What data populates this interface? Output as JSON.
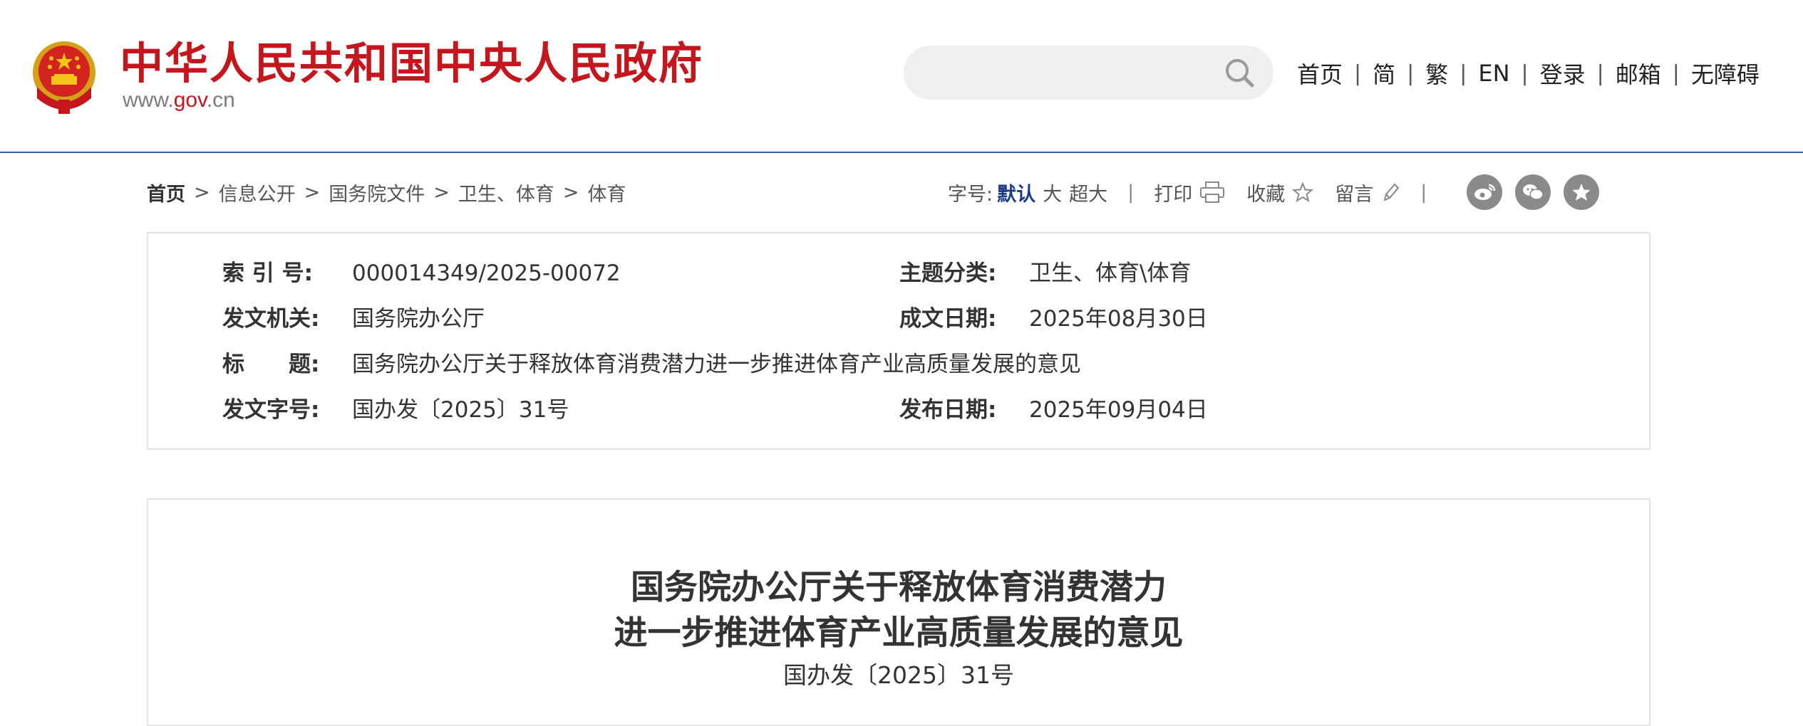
{
  "header": {
    "site_name": "中华人民共和国中央人民政府",
    "site_url_prefix": "www.",
    "site_url_domain": "gov",
    "site_url_suffix": ".cn",
    "emblem_icon": "national-emblem-icon",
    "search": {
      "placeholder": "",
      "icon": "search-icon"
    },
    "nav": [
      "首页",
      "简",
      "繁",
      "EN",
      "登录",
      "邮箱",
      "无障碍"
    ],
    "colors": {
      "brand_red": "#c4161c",
      "rule_blue": "#2f5fa6"
    }
  },
  "breadcrumb": {
    "items": [
      "首页",
      "信息公开",
      "国务院文件",
      "卫生、体育",
      "体育"
    ],
    "separator": ">"
  },
  "toolbar": {
    "font_size_label": "字号:",
    "font_default": "默认",
    "font_large": "大",
    "font_xlarge": "超大",
    "divider": "|",
    "print_label": "打印",
    "favorite_label": "收藏",
    "comment_label": "留言",
    "share_icons": [
      "weibo-icon",
      "wechat-icon",
      "qzone-icon"
    ]
  },
  "meta": {
    "index_label": "索 引 号:",
    "index_value": "000014349/2025-00072",
    "topic_label": "主题分类:",
    "topic_value": "卫生、体育\\体育",
    "issuer_label": "发文机关:",
    "issuer_value": "国务院办公厅",
    "written_label": "成文日期:",
    "written_value": "2025年08月30日",
    "title_label": "标　　题:",
    "title_value": "国务院办公厅关于释放体育消费潜力进一步推进体育产业高质量发展的意见",
    "docno_label": "发文字号:",
    "docno_value": "国办发〔2025〕31号",
    "published_label": "发布日期:",
    "published_value": "2025年09月04日"
  },
  "article": {
    "title_line1": "国务院办公厅关于释放体育消费潜力",
    "title_line2": "进一步推进体育产业高质量发展的意见",
    "doc_number": "国办发〔2025〕31号"
  }
}
